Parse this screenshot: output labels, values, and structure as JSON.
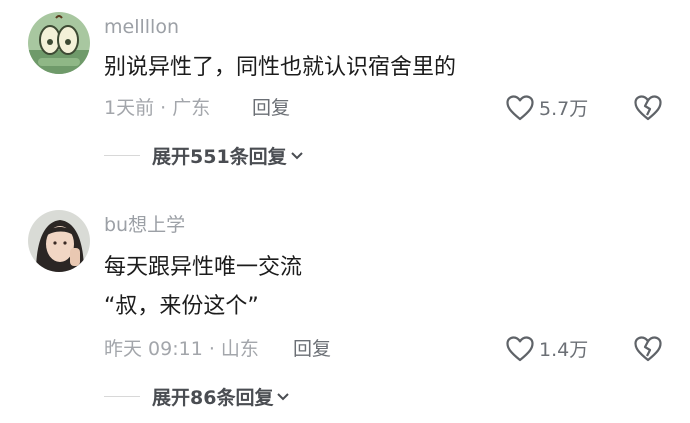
{
  "comments": [
    {
      "username": "mellllon",
      "text_lines": [
        "别说异性了，同性也就认识宿舍里的"
      ],
      "time": "1天前",
      "location": "广东",
      "reply_label": "回复",
      "likes": "5.7万",
      "expand_label": "展开551条回复",
      "avatar_icon": "cartoon-apple-avatar"
    },
    {
      "username": "bu想上学",
      "text_lines": [
        "每天跟异性唯一交流",
        "“叔，来份这个”"
      ],
      "time": "昨天 09:11",
      "location": "山东",
      "reply_label": "回复",
      "likes": "1.4万",
      "expand_label": "展开86条回复",
      "avatar_icon": "portrait-photo-avatar"
    }
  ],
  "icons": {
    "like": "heart-outline-icon",
    "dislike": "broken-heart-icon",
    "expand": "chevron-down-icon"
  },
  "colors": {
    "primary_text": "#1c1c1c",
    "secondary_text": "#9ca0a6",
    "action_text": "#6b6f75"
  }
}
